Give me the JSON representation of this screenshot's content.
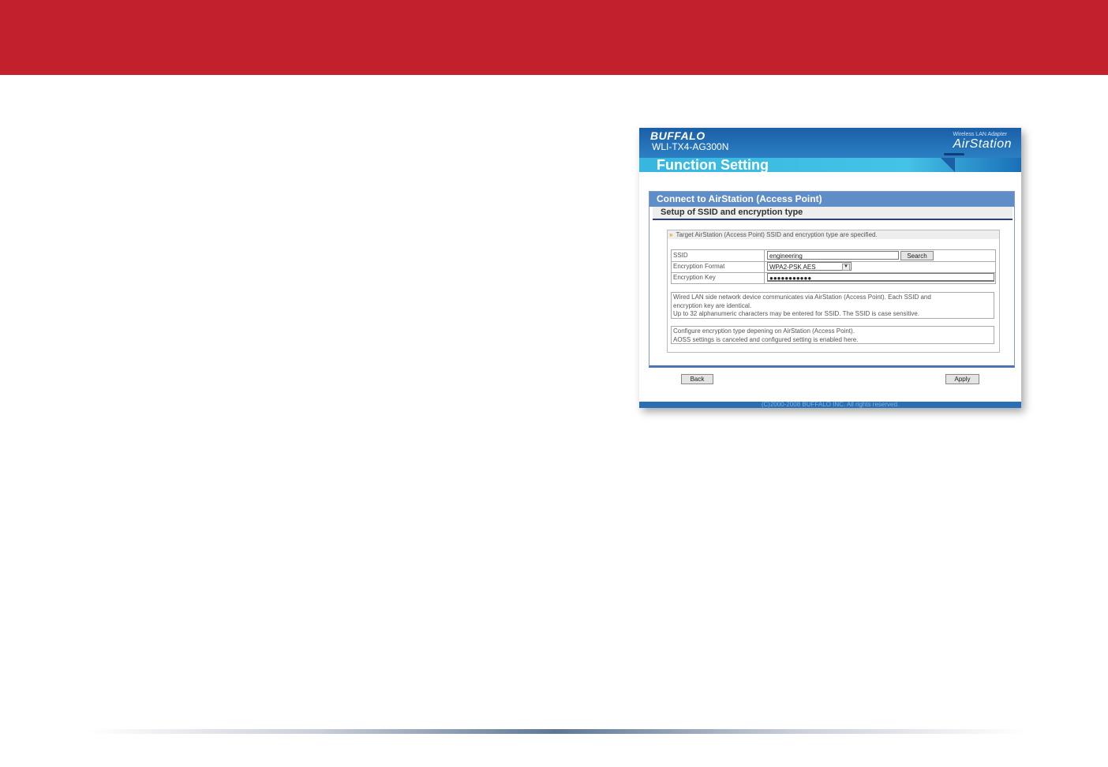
{
  "colors": {
    "top_band": "#c2202c",
    "header_blue": "#1a5fa8",
    "band_cyan": "#45c3e6",
    "panel_blue": "#5f8dc8"
  },
  "header": {
    "brand": "BUFFALO",
    "model": "WLI-TX4-AG300N",
    "adapter_label": "Wireless LAN Adapter",
    "product_logo": "AirStation",
    "page_title": "Function Setting"
  },
  "panel": {
    "title": "Connect to AirStation (Access Point)",
    "subtitle": "Setup of SSID and encryption type",
    "info_icon": "double-arrow-icon",
    "info_text": "Target AirStation (Access Point) SSID and encryption type are specified.",
    "rows": {
      "ssid_label": "SSID",
      "ssid_value": "engineering",
      "search_label": "Search",
      "format_label": "Encryption Format",
      "format_value": "WPA2-PSK AES",
      "key_label": "Encryption Key",
      "key_value": "●●●●●●●●●●●"
    },
    "note1_line1": "Wired LAN side network device communicates via AirStation (Access Point). Each SSID and",
    "note1_line2": "encryption key are identical.",
    "note1_line3": "Up to 32 alphanumeric characters may be entered for SSID. The SSID is case sensitive.",
    "note2_line1": "Configure encryption type depening on AirStation (Access Point).",
    "note2_line2": "AOSS settings is canceled and configured setting is enabled here."
  },
  "buttons": {
    "back": "Back",
    "apply": "Apply"
  },
  "footer": "(C)2000-2008 BUFFALO INC. All rights reserved."
}
